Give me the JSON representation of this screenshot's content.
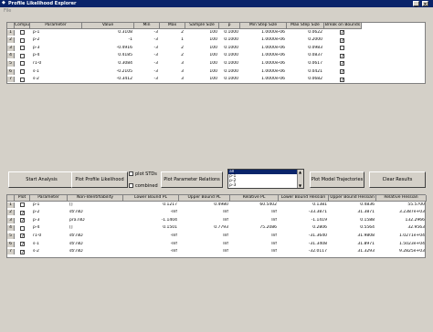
{
  "window": {
    "title": "Profile Likelihood Explorer",
    "menu_file": "File"
  },
  "top_table": {
    "columns": [
      "",
      "Compute",
      "Parameter",
      "Value",
      "Min",
      "Max",
      "Sample Size",
      "p",
      "Min Step Size",
      "Max Step Size",
      "Break on Bounds"
    ],
    "rows": [
      {
        "n": "1",
        "compute": false,
        "param": "p-1",
        "value": "0.3108",
        "min": "-3",
        "max": "2",
        "sample": "100",
        "p": "0.1000",
        "minstep": "1.0000e-06",
        "maxstep": "0.0622",
        "brk": true
      },
      {
        "n": "2",
        "compute": false,
        "param": "p-2",
        "value": "-1",
        "min": "-3",
        "max": "1",
        "sample": "100",
        "p": "0.1000",
        "minstep": "1.0000e-06",
        "maxstep": "0.2000",
        "brk": true
      },
      {
        "n": "3",
        "compute": false,
        "param": "p-3",
        "value": "-0.4916",
        "min": "-3",
        "max": "2",
        "sample": "100",
        "p": "0.1000",
        "minstep": "1.0000e-06",
        "maxstep": "0.0983",
        "brk": false
      },
      {
        "n": "4",
        "compute": false,
        "param": "p-4",
        "value": "0.4185",
        "min": "-3",
        "max": "2",
        "sample": "100",
        "p": "0.1000",
        "minstep": "1.0000e-06",
        "maxstep": "0.0837",
        "brk": true
      },
      {
        "n": "5",
        "compute": false,
        "param": "r1-0",
        "value": "0.3084",
        "min": "-3",
        "max": "3",
        "sample": "100",
        "p": "0.1000",
        "minstep": "1.0000e-06",
        "maxstep": "0.0617",
        "brk": true
      },
      {
        "n": "6",
        "compute": false,
        "param": "s-1",
        "value": "-0.2105",
        "min": "-3",
        "max": "3",
        "sample": "100",
        "p": "0.1000",
        "minstep": "1.0000e-06",
        "maxstep": "0.0421",
        "brk": true
      },
      {
        "n": "7",
        "compute": false,
        "param": "s-2",
        "value": "-0.3412",
        "min": "-3",
        "max": "3",
        "sample": "100",
        "p": "0.1000",
        "minstep": "1.0000e-06",
        "maxstep": "0.0682",
        "brk": true
      }
    ]
  },
  "toolbar": {
    "start_analysis": "Start Analysis",
    "plot_profile": "Plot Profile Likelihood",
    "plot_stds": "plot STDs",
    "combined": "combined",
    "plot_relations": "Plot Parameter Relations",
    "plot_model": "Plot Model Trajectories",
    "clear_results": "Clear Results",
    "list_items": [
      "all",
      "p-1",
      "p-2",
      "p-3"
    ]
  },
  "bottom_table": {
    "columns": [
      "",
      "Plot",
      "Parameter",
      "Non-Identifiability",
      "Lower Bound PL",
      "Upper Bound PL",
      "Relative PL",
      "Lower Bound Hessian",
      "Upper Bound Hessian",
      "Relative Hessian"
    ],
    "rows": [
      {
        "n": "1",
        "plot": false,
        "param": "p-1",
        "nonid": "[]",
        "lbpl": "0.1217",
        "ubpl": "0.4980",
        "relpl": "60.5402",
        "lbh": "0.1381",
        "ubh": "0.4836",
        "relh": "55.5700"
      },
      {
        "n": "2",
        "plot": true,
        "param": "p-2",
        "nonid": "str.nID",
        "lbpl": "-Inf",
        "ubpl": "Inf",
        "relpl": "Inf",
        "lbh": "-33.3871",
        "ubh": "31.3871",
        "relh": "3.2387e+03"
      },
      {
        "n": "3",
        "plot": true,
        "param": "p-3",
        "nonid": "pra.nID",
        "lbpl": "-1.1404",
        "ubpl": "Inf",
        "relpl": "Inf",
        "lbh": "-1.1419",
        "ubh": "0.1588",
        "relh": "132.2966"
      },
      {
        "n": "4",
        "plot": false,
        "param": "p-4",
        "nonid": "[]",
        "lbpl": "0.1501",
        "ubpl": "0.7793",
        "relpl": "75.2086",
        "lbh": "0.2806",
        "ubh": "0.5564",
        "relh": "32.9563"
      },
      {
        "n": "5",
        "plot": true,
        "param": "r1-0",
        "nonid": "str.nID",
        "lbpl": "-Inf",
        "ubpl": "Inf",
        "relpl": "Inf",
        "lbh": "-31.3640",
        "ubh": "31.9808",
        "relh": "1.0271e+04"
      },
      {
        "n": "6",
        "plot": true,
        "param": "s-1",
        "nonid": "str.nID",
        "lbpl": "-Inf",
        "ubpl": "Inf",
        "relpl": "Inf",
        "lbh": "-31.3408",
        "ubh": "31.8971",
        "relh": "1.5023e+04"
      },
      {
        "n": "7",
        "plot": true,
        "param": "s-2",
        "nonid": "str.nID",
        "lbpl": "-Inf",
        "ubpl": "Inf",
        "relpl": "Inf",
        "lbh": "-32.0117",
        "ubh": "31.3293",
        "relh": "9.2825e+03"
      }
    ]
  }
}
